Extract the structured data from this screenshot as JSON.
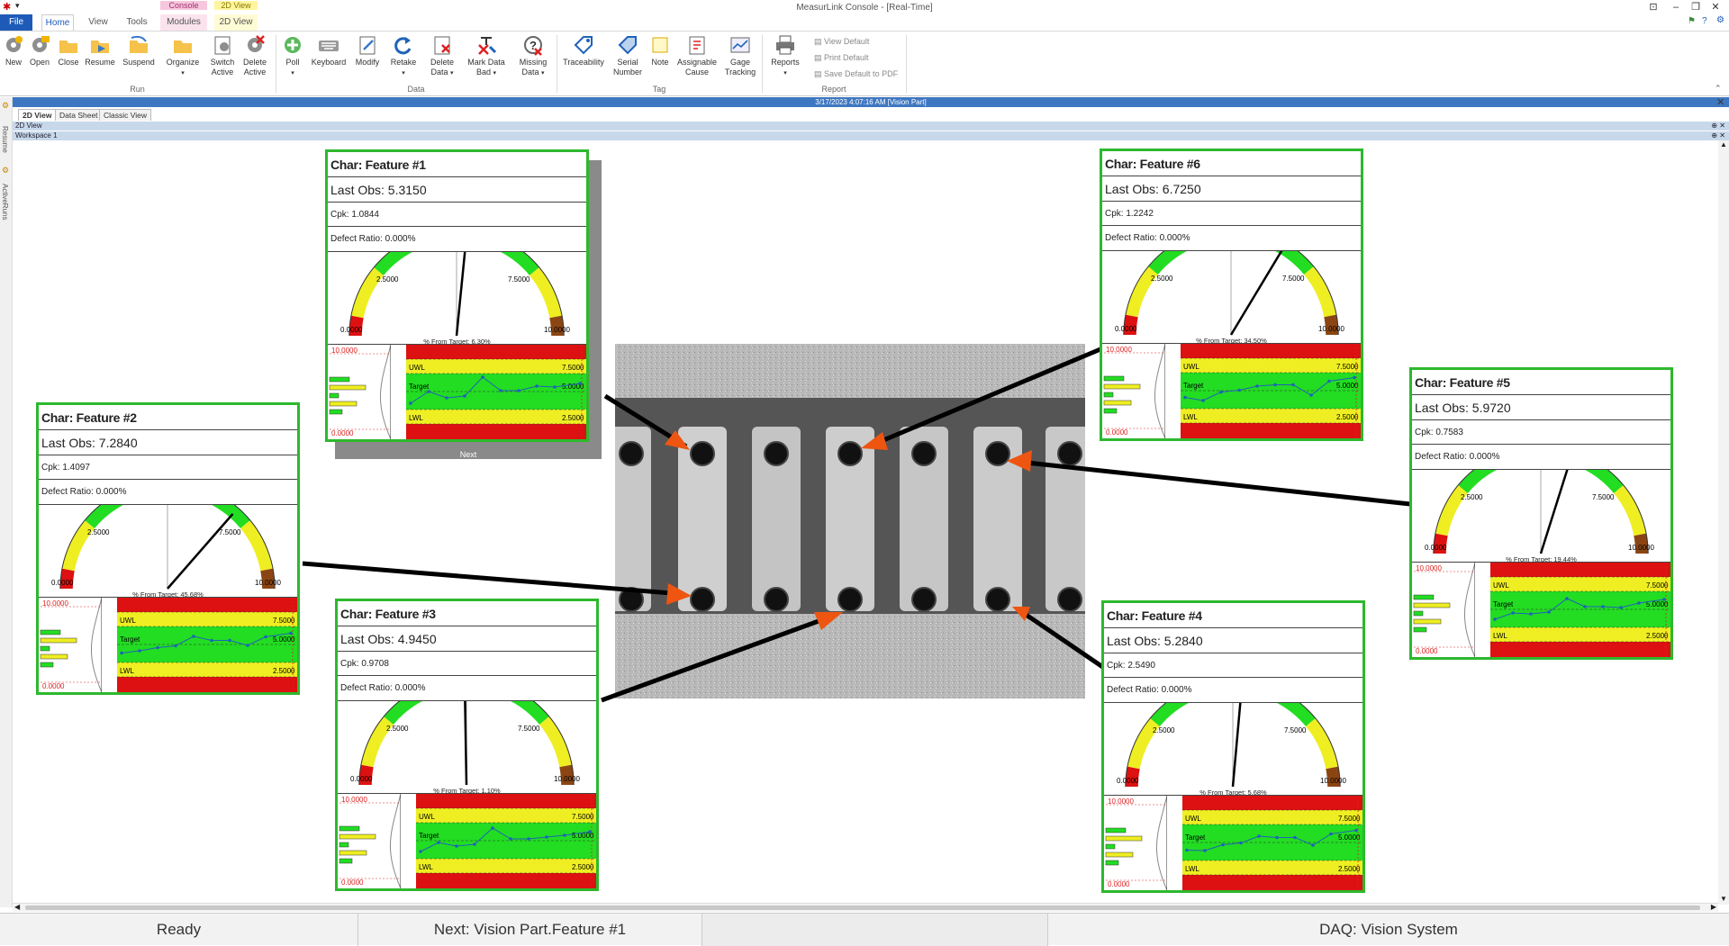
{
  "window": {
    "title": "MeasurLink Console - [Real-Time]"
  },
  "context_tabs": {
    "console_label": "Console",
    "view2d_label": "2D View"
  },
  "ribbon_tabs": [
    "File",
    "Home",
    "View",
    "Tools",
    "Modules",
    "2D View"
  ],
  "ribbon": {
    "run_buttons": [
      "New",
      "Open",
      "Close",
      "Resume",
      "Suspend",
      "Organize",
      "Switch\nActive",
      "Delete\nActive"
    ],
    "data_buttons": [
      "Poll",
      "Keyboard",
      "Modify",
      "Retake",
      "Delete\nData",
      "Mark Data\nBad",
      "Missing\nData"
    ],
    "tag_buttons": [
      "Traceability",
      "Serial\nNumber",
      "Note",
      "Assignable\nCause",
      "Gage\nTracking"
    ],
    "report_button": "Reports",
    "report_small": [
      "View Default",
      "Print Default",
      "Save Default to PDF"
    ],
    "groups": [
      "Run",
      "Data",
      "Tag",
      "Report"
    ]
  },
  "info_bar": "3/17/2023 4:07:16 AM [Vision Part]",
  "side_labels": [
    "Resume",
    "ActiveRuns"
  ],
  "view_tabs": [
    "2D View",
    "Data Sheet",
    "Classic View"
  ],
  "pane_headers": {
    "view": "2D View",
    "workspace": "Workspace 1"
  },
  "next_label": "Next",
  "features": [
    {
      "name": "Char: Feature #1",
      "last_obs": "Last Obs: 5.3150",
      "cpk": "Cpk: 1.0844",
      "defect": "Defect Ratio: 0.000%",
      "from_target": "% From Target: 6.30%",
      "needle_value": 5.315
    },
    {
      "name": "Char: Feature #2",
      "last_obs": "Last Obs: 7.2840",
      "cpk": "Cpk: 1.4097",
      "defect": "Defect Ratio: 0.000%",
      "from_target": "% From Target: 45.68%",
      "needle_value": 7.284
    },
    {
      "name": "Char: Feature #3",
      "last_obs": "Last Obs: 4.9450",
      "cpk": "Cpk: 0.9708",
      "defect": "Defect Ratio: 0.000%",
      "from_target": "% From Target: 1.10%",
      "needle_value": 4.945
    },
    {
      "name": "Char: Feature #4",
      "last_obs": "Last Obs: 5.2840",
      "cpk": "Cpk: 2.5490",
      "defect": "Defect Ratio: 0.000%",
      "from_target": "% From Target: 5.68%",
      "needle_value": 5.284
    },
    {
      "name": "Char: Feature #5",
      "last_obs": "Last Obs: 5.9720",
      "cpk": "Cpk: 0.7583",
      "defect": "Defect Ratio: 0.000%",
      "from_target": "% From Target: 19.44%",
      "needle_value": 5.972
    },
    {
      "name": "Char: Feature #6",
      "last_obs": "Last Obs: 6.7250",
      "cpk": "Cpk: 1.2242",
      "defect": "Defect Ratio: 0.000%",
      "from_target": "% From Target: 34.50%",
      "needle_value": 6.725
    }
  ],
  "gauge_labels": {
    "min": "0.0000",
    "q1": "2.5000",
    "q3": "7.5000",
    "max": "10.0000"
  },
  "control_labels": {
    "uwl": "UWL",
    "lwl": "LWL",
    "target": "Target",
    "top": "10.0000",
    "upper": "7.5000",
    "mid": "5.0000",
    "lower": "2.5000",
    "bottom": "0.0000"
  },
  "status": {
    "state": "Ready",
    "next": "Next: Vision Part.Feature #1",
    "daq": "DAQ: Vision System"
  },
  "colors": {
    "card_border": "#2db82d",
    "accent_blue": "#1e5bb8",
    "gauge_green": "#22dd22",
    "gauge_yellow": "#eeee22",
    "gauge_red": "#dd1111",
    "arrow_orange": "#ee5511"
  }
}
